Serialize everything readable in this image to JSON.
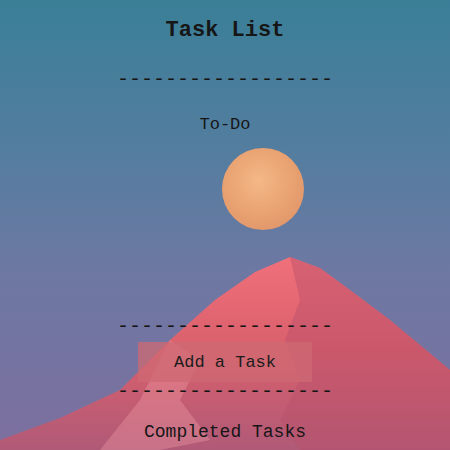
{
  "title": "Task List",
  "divider": "------------------",
  "todo": {
    "heading": "To-Do",
    "tasks": []
  },
  "add_button": {
    "label": "Add a Task"
  },
  "completed": {
    "heading": "Completed Tasks",
    "tasks": []
  }
}
